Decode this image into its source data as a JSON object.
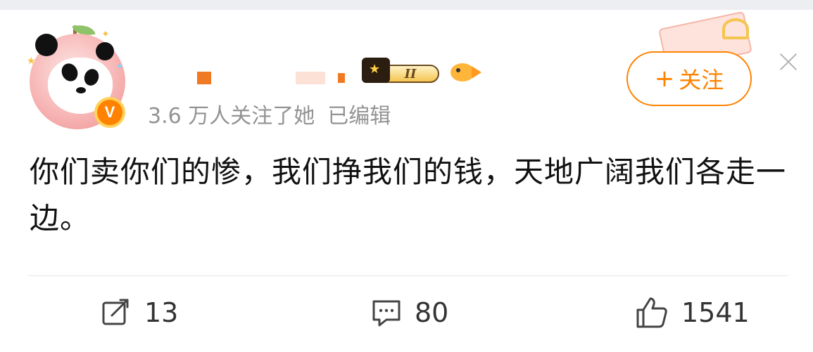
{
  "header": {
    "verified_badge": "V",
    "level_badge": "II",
    "follow_button": {
      "icon": "+",
      "label": "关注"
    },
    "close_icon": "close-icon"
  },
  "meta": {
    "followers": "3.6 万人关注了她",
    "edited": "已编辑"
  },
  "post": {
    "text": "你们卖你们的惨，我们挣我们的钱，天地广阔我们各走一边。"
  },
  "actions": {
    "repost_count": "13",
    "comment_count": "80",
    "like_count": "1541"
  },
  "colors": {
    "accent": "#ff8200",
    "meta_text": "#939393",
    "body_text": "#111111"
  }
}
